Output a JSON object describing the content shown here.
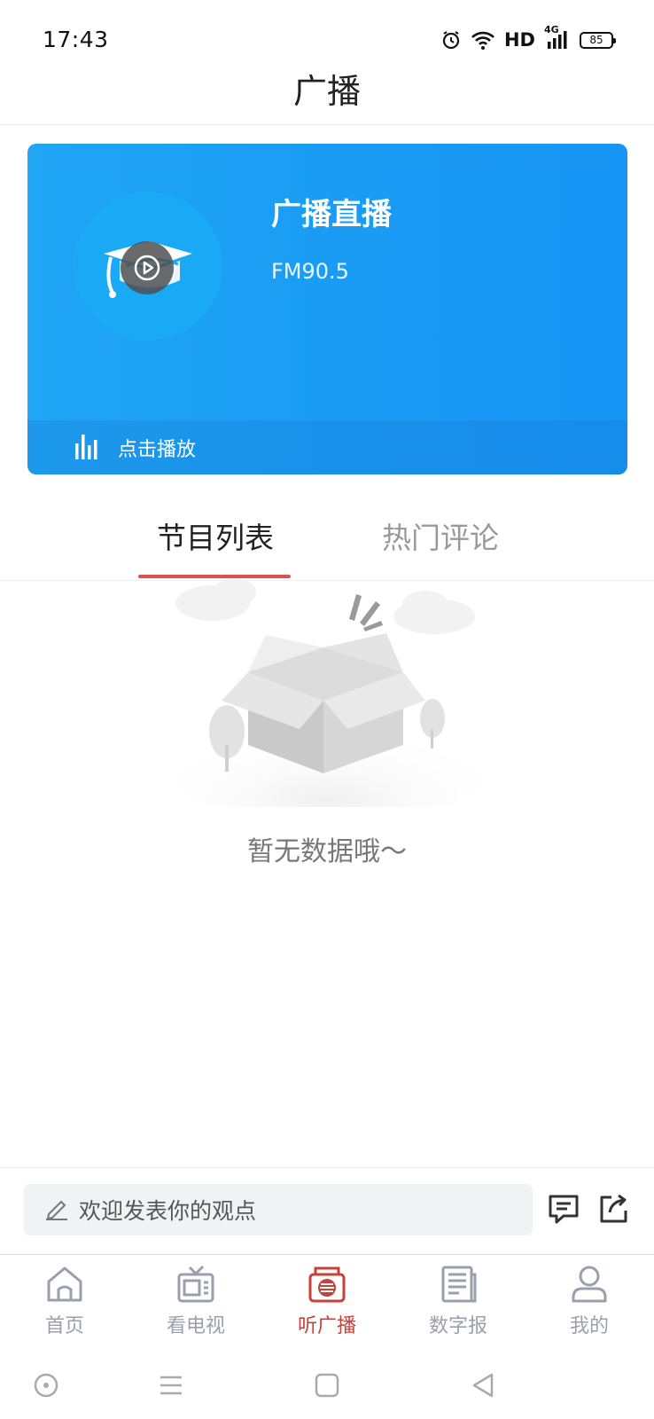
{
  "status_bar": {
    "time": "17:43",
    "network_label": "HD",
    "signal_label": "4G",
    "battery_level": "85",
    "icons": [
      "alarm-icon",
      "wifi-icon",
      "signal-icon",
      "battery-icon"
    ]
  },
  "header": {
    "title": "广播"
  },
  "live_card": {
    "title": "广播直播",
    "frequency": "FM90.5",
    "play_label": "点击播放",
    "colors": {
      "start": "#20a6f5",
      "end": "#1795f5"
    }
  },
  "tabs": [
    {
      "label": "节目列表",
      "active": true
    },
    {
      "label": "热门评论",
      "active": false
    }
  ],
  "empty_state": {
    "message": "暂无数据哦～"
  },
  "comment_bar": {
    "placeholder": "欢迎发表你的观点",
    "icons": [
      "edit-icon",
      "comment-list-icon",
      "share-icon"
    ]
  },
  "bottom_nav": {
    "items": [
      {
        "label": "首页",
        "icon": "home-icon",
        "active": false
      },
      {
        "label": "看电视",
        "icon": "tv-icon",
        "active": false
      },
      {
        "label": "听广播",
        "icon": "radio-icon",
        "active": true
      },
      {
        "label": "数字报",
        "icon": "newspaper-icon",
        "active": false
      },
      {
        "label": "我的",
        "icon": "user-icon",
        "active": false
      }
    ],
    "active_color": "#c8403a",
    "inactive_color": "#9aa0ab"
  },
  "accent_color": "#d9534f"
}
